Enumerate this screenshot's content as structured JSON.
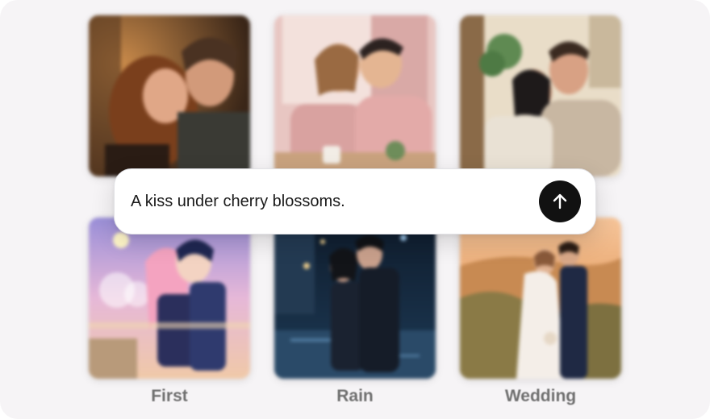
{
  "prompt": {
    "value": "A kiss under cherry blossoms.",
    "send_icon": "arrow-up-icon"
  },
  "gallery": {
    "items": [
      {
        "caption": ""
      },
      {
        "caption": ""
      },
      {
        "caption": ""
      },
      {
        "caption": "First"
      },
      {
        "caption": "Rain"
      },
      {
        "caption": "Wedding"
      }
    ]
  },
  "colors": {
    "background": "#f6f4f6",
    "send_button": "#111111",
    "caption": "#707070"
  }
}
